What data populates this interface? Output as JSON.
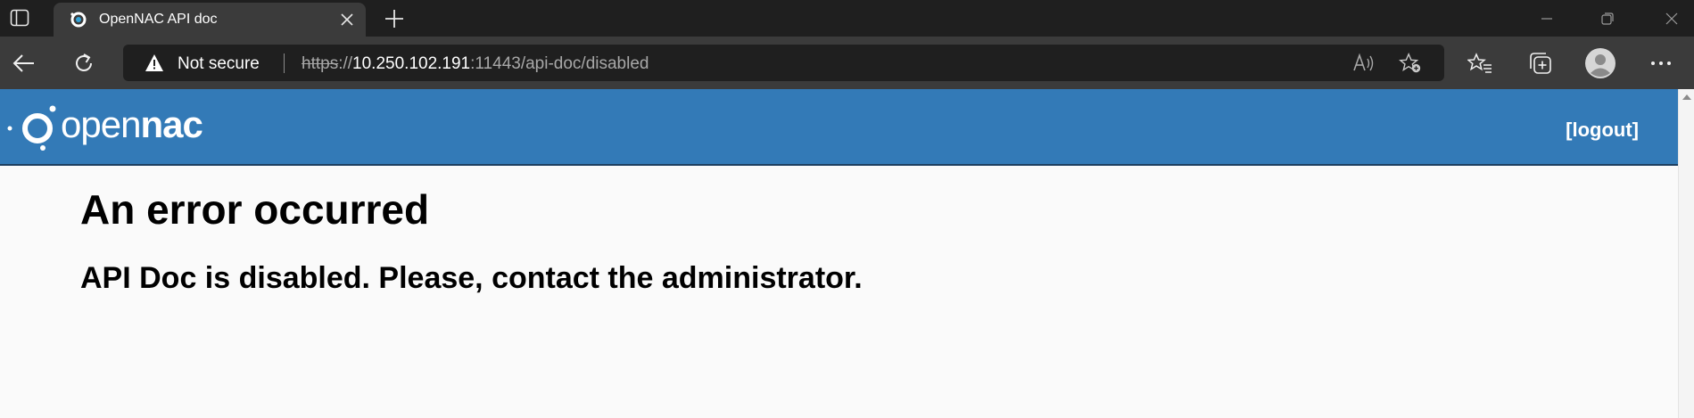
{
  "browser": {
    "tab": {
      "title": "OpenNAC API doc"
    },
    "address_bar": {
      "security_label": "Not secure",
      "url_scheme": "https",
      "url_separator": "://",
      "url_host": "10.250.102.191",
      "url_rest": ":11443/api-doc/disabled"
    },
    "colors": {
      "titlebar": "#1f1f1f",
      "toolbar": "#3b3b3b",
      "active_tab": "#3b3b3b"
    }
  },
  "app": {
    "logo": {
      "light": "open",
      "bold": "nac"
    },
    "header": {
      "logout_label": "[logout]",
      "color": "#337ab7"
    },
    "error": {
      "title": "An error occurred",
      "message": "API Doc is disabled. Please, contact the administrator."
    }
  }
}
